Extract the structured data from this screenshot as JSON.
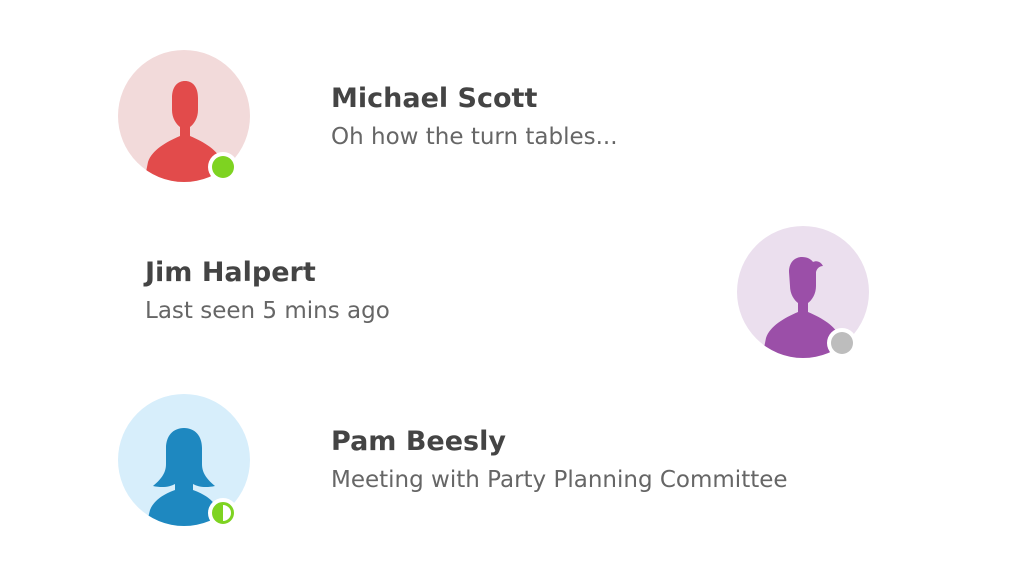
{
  "contacts": [
    {
      "name": "Michael Scott",
      "message": "Oh how the turn tables...",
      "status": "online",
      "avatar_icon": "male-person-icon",
      "avatar_bg": "#f2dada",
      "avatar_fg": "#e24b4b"
    },
    {
      "name": "Jim Halpert",
      "message": "Last seen 5 mins ago",
      "status": "offline",
      "avatar_icon": "male-person-icon",
      "avatar_bg": "#ebdfee",
      "avatar_fg": "#9b4fa8"
    },
    {
      "name": "Pam Beesly",
      "message": "Meeting with Party Planning Committee",
      "status": "away",
      "avatar_icon": "female-person-icon",
      "avatar_bg": "#d7eefb",
      "avatar_fg": "#1e88c0"
    }
  ],
  "colors": {
    "online": "#7ed321",
    "offline": "#bdbdbd",
    "name_text": "#444444",
    "message_text": "#666666"
  }
}
